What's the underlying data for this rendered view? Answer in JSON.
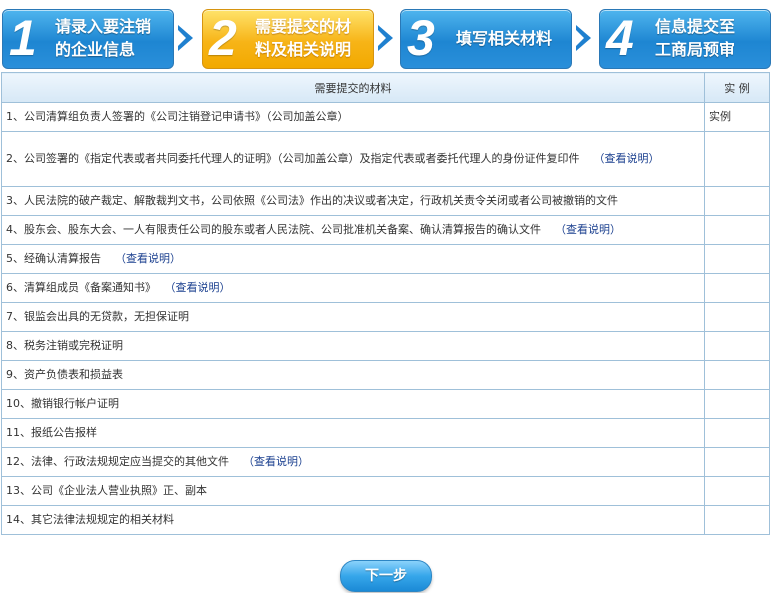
{
  "steps": [
    {
      "num": "1",
      "line1": "请录入要注销",
      "line2": "的企业信息"
    },
    {
      "num": "2",
      "line1": "需要提交的材",
      "line2": "料及相关说明"
    },
    {
      "num": "3",
      "line1": "填写相关材料",
      "line2": ""
    },
    {
      "num": "4",
      "line1": "信息提交至",
      "line2": "工商局预审"
    }
  ],
  "active_step": 2,
  "table": {
    "header_material": "需要提交的材料",
    "header_example": "实 例",
    "rows": [
      {
        "text": "1、公司清算组负责人签署的《公司注销登记申请书》（公司加盖公章）",
        "link": "",
        "example": "实例"
      },
      {
        "text": "2、公司签署的《指定代表或者共同委托代理人的证明》（公司加盖公章）及指定代表或者委托代理人的身份证件复印件",
        "link": "（查看说明）",
        "example": ""
      },
      {
        "text": "3、人民法院的破产裁定、解散裁判文书，公司依照《公司法》作出的决议或者决定，行政机关责令关闭或者公司被撤销的文件",
        "link": "",
        "example": ""
      },
      {
        "text": "4、股东会、股东大会、一人有限责任公司的股东或者人民法院、公司批准机关备案、确认清算报告的确认文件",
        "link": "（查看说明）",
        "example": ""
      },
      {
        "text": "5、经确认清算报告",
        "link": "（查看说明）",
        "example": ""
      },
      {
        "text": "6、清算组成员《备案通知书》",
        "link": "（查看说明）",
        "example": ""
      },
      {
        "text": "7、银监会出具的无贷款，无担保证明",
        "link": "",
        "example": ""
      },
      {
        "text": "8、税务注销或完税证明",
        "link": "",
        "example": ""
      },
      {
        "text": "9、资产负债表和损益表",
        "link": "",
        "example": ""
      },
      {
        "text": "10、撤销银行帐户证明",
        "link": "",
        "example": ""
      },
      {
        "text": "11、报纸公告报样",
        "link": "",
        "example": ""
      },
      {
        "text": "12、法律、行政法规规定应当提交的其他文件",
        "link": "（查看说明）",
        "example": ""
      },
      {
        "text": "13、公司《企业法人营业执照》正、副本",
        "link": "",
        "example": ""
      },
      {
        "text": "14、其它法律法规规定的相关材料",
        "link": "",
        "example": ""
      }
    ]
  },
  "next_label": "下一步"
}
